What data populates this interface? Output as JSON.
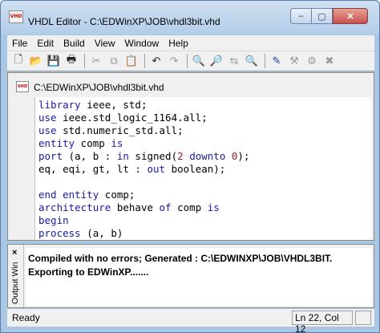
{
  "window": {
    "title": "VHDL Editor - C:\\EDWinXP\\JOB\\vhdl3bit.vhd",
    "icon": "app-doc-icon"
  },
  "window_controls": {
    "minimize": "–",
    "maximize": "▢",
    "close": "✕"
  },
  "menu": [
    "File",
    "Edit",
    "Build",
    "View",
    "Window",
    "Help"
  ],
  "toolbar": [
    {
      "name": "new-icon",
      "glyph": "🗋"
    },
    {
      "name": "open-folder-icon",
      "glyph": "📂"
    },
    {
      "name": "save-icon",
      "glyph": "💾"
    },
    {
      "name": "print-icon",
      "glyph": "🖶"
    },
    {
      "name": "cut-icon",
      "glyph": "✂"
    },
    {
      "name": "copy-icon",
      "glyph": "⧉"
    },
    {
      "name": "paste-icon",
      "glyph": "📋"
    },
    {
      "name": "undo-icon",
      "glyph": "↶"
    },
    {
      "name": "redo-icon",
      "glyph": "↷"
    },
    {
      "name": "find-icon",
      "glyph": "🔍"
    },
    {
      "name": "find-next-icon",
      "glyph": "🔎"
    },
    {
      "name": "replace-icon",
      "glyph": "⇆"
    },
    {
      "name": "find-red-icon",
      "glyph": "🔍"
    },
    {
      "name": "compile-icon",
      "glyph": "✎"
    },
    {
      "name": "build-icon",
      "glyph": "⚒"
    },
    {
      "name": "run-icon",
      "glyph": "⚙"
    },
    {
      "name": "stop-icon",
      "glyph": "✖"
    }
  ],
  "document": {
    "tab_title": "C:\\EDWinXP\\JOB\\vhdl3bit.vhd"
  },
  "code_lines": [
    [
      {
        "t": "library",
        "c": "kw"
      },
      {
        "t": " ieee, std;"
      }
    ],
    [
      {
        "t": "use",
        "c": "kw"
      },
      {
        "t": " ieee.std_logic_1164.all;"
      }
    ],
    [
      {
        "t": "use",
        "c": "kw"
      },
      {
        "t": " std.numeric_std.all;"
      }
    ],
    [
      {
        "t": "entity",
        "c": "kw"
      },
      {
        "t": " comp "
      },
      {
        "t": "is",
        "c": "kw"
      }
    ],
    [
      {
        "t": "port",
        "c": "kw"
      },
      {
        "t": " (a, b : "
      },
      {
        "t": "in",
        "c": "kw"
      },
      {
        "t": " signed("
      },
      {
        "t": "2",
        "c": "num"
      },
      {
        "t": " "
      },
      {
        "t": "downto",
        "c": "kw"
      },
      {
        "t": " "
      },
      {
        "t": "0",
        "c": "num"
      },
      {
        "t": ");"
      }
    ],
    [
      {
        "t": "eq, eqi, gt, lt : "
      },
      {
        "t": "out",
        "c": "kw"
      },
      {
        "t": " boolean);"
      }
    ],
    [
      {
        "t": ""
      }
    ],
    [
      {
        "t": "end",
        "c": "kw"
      },
      {
        "t": " "
      },
      {
        "t": "entity",
        "c": "kw"
      },
      {
        "t": " comp;"
      }
    ],
    [
      {
        "t": "architecture",
        "c": "kw"
      },
      {
        "t": " behave "
      },
      {
        "t": "of",
        "c": "kw"
      },
      {
        "t": " comp "
      },
      {
        "t": "is",
        "c": "kw"
      }
    ],
    [
      {
        "t": "begin",
        "c": "kw"
      }
    ],
    [
      {
        "t": "process",
        "c": "kw"
      },
      {
        "t": " (a, b)"
      }
    ]
  ],
  "output": {
    "label": "Output Win",
    "close": "×",
    "lines": [
      "Compiled with no errors; Generated : C:\\EDWINXP\\JOB\\VHDL3BIT.",
      "Exporting to EDWinXP......."
    ]
  },
  "status": {
    "left": "Ready",
    "position": "Ln 22, Col 12"
  }
}
